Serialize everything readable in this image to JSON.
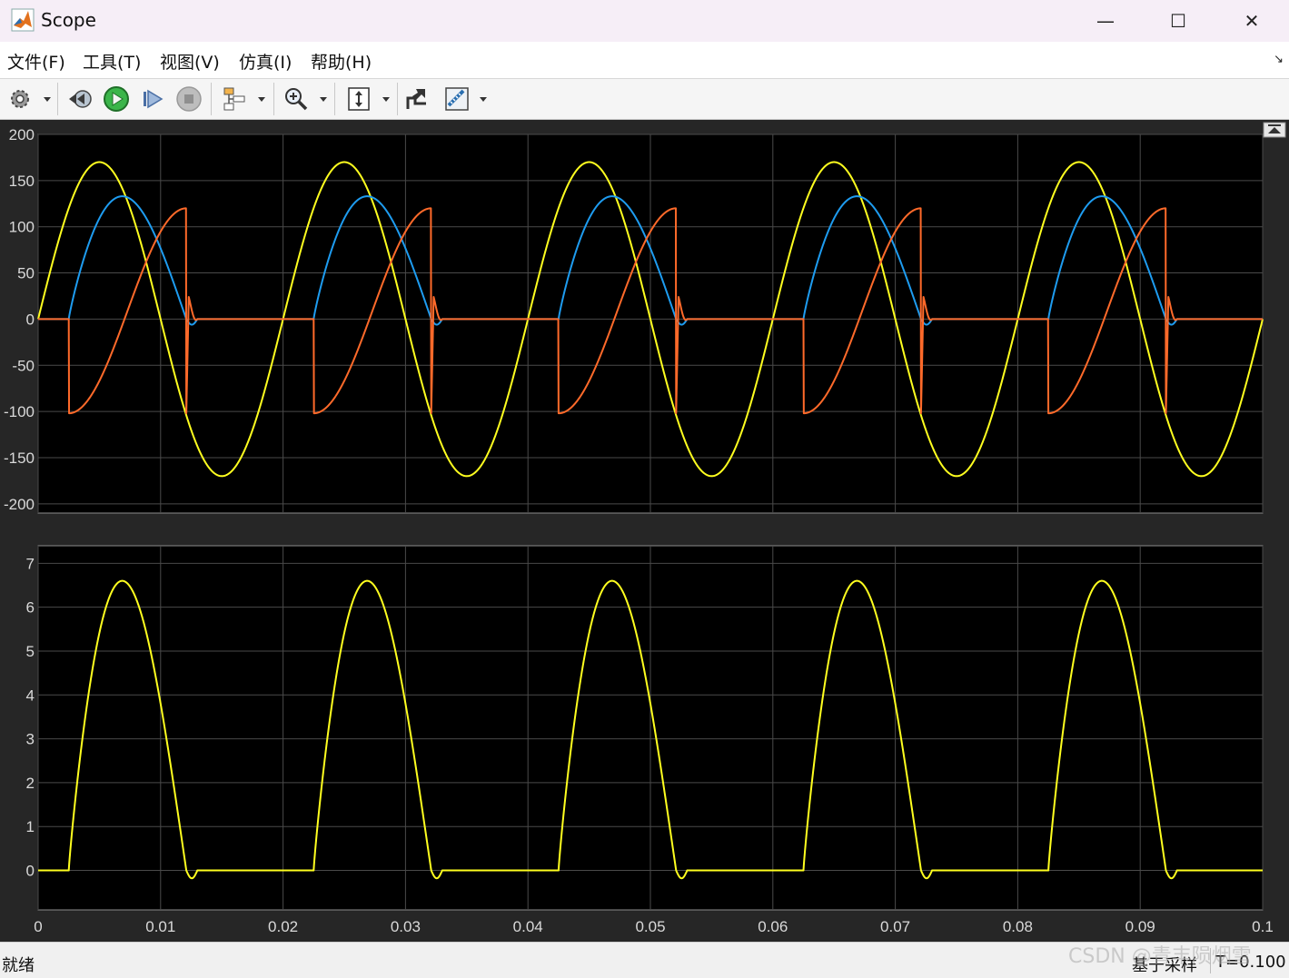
{
  "window": {
    "title": "Scope",
    "controls": {
      "minimize": "—",
      "maximize": "☐",
      "close": "✕"
    }
  },
  "menu": [
    {
      "label": "文件(F)"
    },
    {
      "label": "工具(T)"
    },
    {
      "label": "视图(V)"
    },
    {
      "label": "仿真(I)"
    },
    {
      "label": "帮助(H)"
    }
  ],
  "toolbar": [
    "settings-icon",
    "step-back-icon",
    "run-icon",
    "step-forward-icon",
    "stop-icon",
    "signal-selector-icon",
    "zoom-icon",
    "autoscale-icon",
    "restore-icon",
    "measurements-icon"
  ],
  "colors": {
    "plot_bg": "#000000",
    "figure_bg": "#262626",
    "grid": "#4a4a4a",
    "axis_text": "#d9d9d9",
    "yellow": "#ffff1f",
    "blue": "#1e9cf0",
    "orange": "#ff6a2a"
  },
  "status": {
    "left": "就绪",
    "mid": "基于采样",
    "right": "T=0.100"
  },
  "watermark": "CSDN @青丰陨烟雪",
  "chart_data": [
    {
      "type": "line",
      "xlim": [
        0,
        0.1
      ],
      "ylim": [
        -210,
        200
      ],
      "yticks": [
        -200,
        -150,
        -100,
        -50,
        0,
        50,
        100,
        150,
        200
      ],
      "ytick_labels": [
        "-200",
        "-150",
        "-100",
        "-50",
        "0",
        "50",
        "100",
        "150",
        "200"
      ],
      "xticks": [
        0,
        0.01,
        0.02,
        0.03,
        0.04,
        0.05,
        0.06,
        0.07,
        0.08,
        0.09,
        0.1
      ],
      "grid": true,
      "series": [
        {
          "color": "#ffff1f",
          "kind": "sine",
          "amplitude": 170,
          "period": 0.02
        },
        {
          "color": "#1e9cf0",
          "kind": "output_voltage",
          "fire": 0.0025,
          "end": 0.0121,
          "peak": 133,
          "peak_at": 0.0072
        },
        {
          "color": "#ff6a2a",
          "kind": "thyristor_voltage",
          "fire_value": 120,
          "off_value": -102,
          "spike": 24
        }
      ]
    },
    {
      "type": "line",
      "xlim": [
        0,
        0.1
      ],
      "ylim": [
        -0.9,
        7.4
      ],
      "yticks": [
        0,
        1,
        2,
        3,
        4,
        5,
        6,
        7
      ],
      "ytick_labels": [
        "0",
        "1",
        "2",
        "3",
        "4",
        "5",
        "6",
        "7"
      ],
      "xticks": [
        0,
        0.01,
        0.02,
        0.03,
        0.04,
        0.05,
        0.06,
        0.07,
        0.08,
        0.09,
        0.1
      ],
      "xtick_labels": [
        "0",
        "0.01",
        "0.02",
        "0.03",
        "0.04",
        "0.05",
        "0.06",
        "0.07",
        "0.08",
        "0.09",
        "0.1"
      ],
      "grid": true,
      "series": [
        {
          "color": "#ffff1f",
          "kind": "load_current",
          "peak": 6.6,
          "peak_at": 0.0072,
          "fire": 0.0025,
          "end": 0.0121
        }
      ]
    }
  ]
}
